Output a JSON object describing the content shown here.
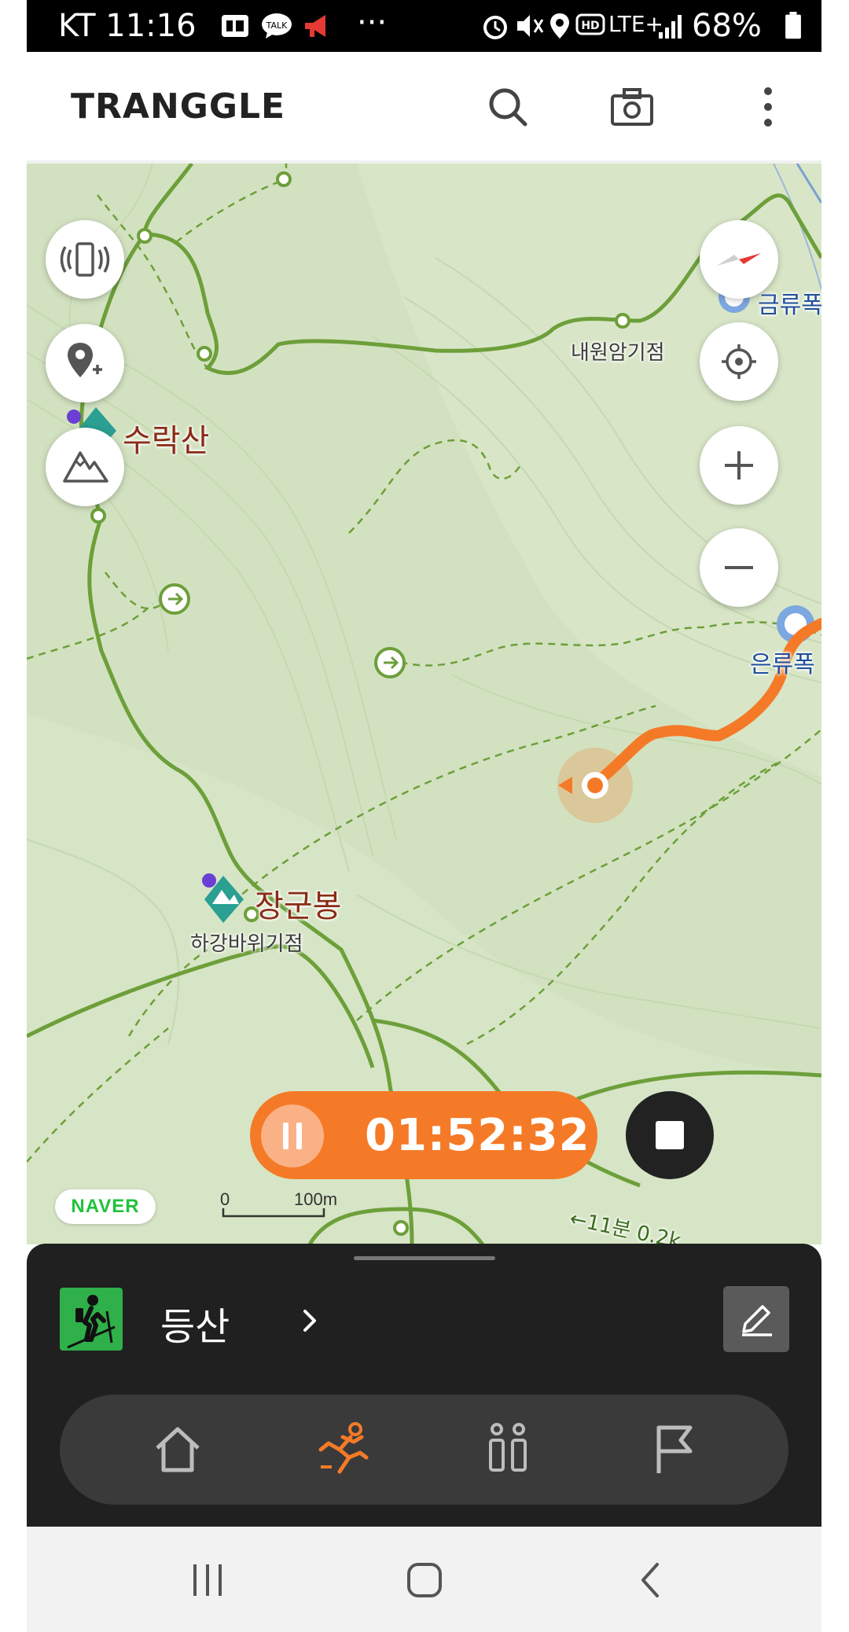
{
  "statusbar": {
    "carrier_time": "KT 11:16",
    "network": "LTE+",
    "battery": "68%",
    "more": "···"
  },
  "header": {
    "logo": "TRANGGLE"
  },
  "map": {
    "peaks": [
      {
        "label": "수락산"
      },
      {
        "label": "장군봉"
      }
    ],
    "places": [
      {
        "label": "내원암기점"
      },
      {
        "label": "하강바위기점"
      },
      {
        "label": "금류폭"
      },
      {
        "label": "은류폭"
      },
      {
        "label": "←11분 0.2k"
      }
    ],
    "naver": "NAVER",
    "scale": {
      "zero": "0",
      "distance": "100m"
    }
  },
  "tracking": {
    "elapsed": "01:52:32"
  },
  "panel": {
    "activity": "등산",
    "tabs": [
      "home",
      "activity",
      "people",
      "flag"
    ],
    "active_tab": "activity"
  },
  "colors": {
    "accent": "#f57a27",
    "map_bg": "#d8e6c7",
    "trail": "#6d9f3a",
    "panel": "#202020"
  }
}
